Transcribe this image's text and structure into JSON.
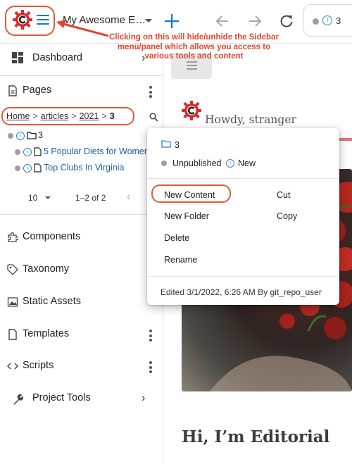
{
  "toolbar": {
    "site_name": "My Awesome E…",
    "tab_text": "3",
    "colors": {
      "accent": "#1f74d6",
      "annotation": "#e5442c",
      "logo_red": "#d92b2b"
    },
    "icons": [
      "crafter-logo-icon",
      "menu-icon",
      "chevron-down-icon",
      "add-icon",
      "back-arrow-icon",
      "forward-arrow-icon",
      "refresh-icon",
      "info-icon"
    ]
  },
  "annotation": {
    "text": "Clicking on this will hide/unhide the Sidebar menu/panel which allows you access to various tools and content"
  },
  "sidebar": {
    "dashboard": "Dashboard",
    "pages": "Pages",
    "breadcrumb": {
      "home": "Home",
      "articles": "articles",
      "year": "2021",
      "current": "3",
      "separator": ">"
    },
    "tree": {
      "folder": "3",
      "items": [
        "5 Popular Diets for Women",
        "Top Clubs In Virginia"
      ]
    },
    "pager": {
      "per_page": "10",
      "range": "1–2 of 2"
    },
    "items": [
      {
        "label": "Components"
      },
      {
        "label": "Taxonomy"
      },
      {
        "label": "Static Assets"
      },
      {
        "label": "Templates"
      },
      {
        "label": "Scripts"
      },
      {
        "label": "Project Tools"
      }
    ]
  },
  "main": {
    "greeting": "Howdy, stranger",
    "heading": "Hi, I’m Editorial"
  },
  "context_menu": {
    "title": "3",
    "status": "Unpublished",
    "status_new": "New",
    "actions": {
      "new_content": "New Content",
      "cut": "Cut",
      "new_folder": "New Folder",
      "copy": "Copy",
      "delete": "Delete",
      "rename": "Rename"
    },
    "footer": "Edited 3/1/2022, 6:26 AM By git_repo_user"
  }
}
